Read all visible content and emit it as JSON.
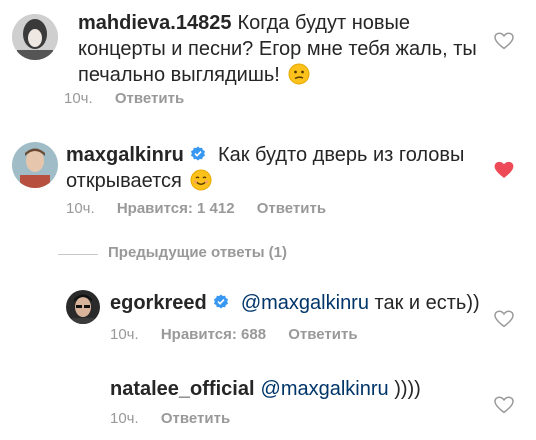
{
  "comments": [
    {
      "username": "mahdieva.14825",
      "text": "Когда будут новые концерты и песни? Егор мне тебя жаль, ты печально выглядишь!",
      "emoji": "confused-face",
      "time": "10ч.",
      "likes": "",
      "reply": "Ответить",
      "liked": false
    },
    {
      "username": "maxgalkinru",
      "verified": true,
      "text": "Как будто дверь из головы открывается",
      "emoji": "smiling-face",
      "time": "10ч.",
      "likes": "Нравится: 1 412",
      "reply": "Ответить",
      "liked": true
    }
  ],
  "previous_replies": "Предыдущие ответы (1)",
  "replies": [
    {
      "username": "egorkreed",
      "verified": true,
      "mention": "@maxgalkinru",
      "text": "так и есть))",
      "time": "10ч.",
      "likes": "Нравится: 688",
      "reply": "Ответить",
      "liked": false
    },
    {
      "username": "natalee_official",
      "mention": "@maxgalkinru",
      "text": "))))",
      "time": "10ч.",
      "reply": "Ответить",
      "liked": false
    }
  ],
  "colors": {
    "like_red": "#ed4956",
    "verified_blue": "#3897f0",
    "meta_gray": "#999999"
  }
}
